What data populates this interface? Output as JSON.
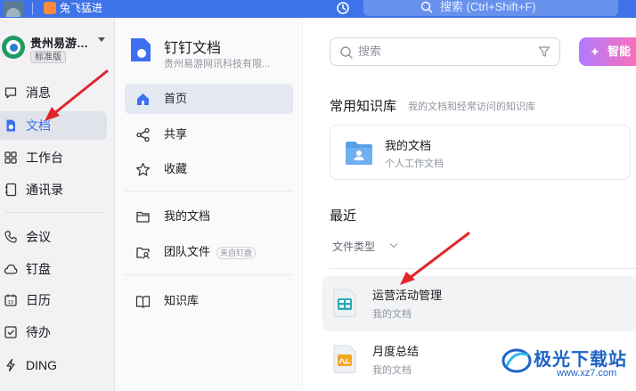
{
  "topbar": {
    "workspace_name": "兔飞猛进",
    "search_placeholder": "搜索 (Ctrl+Shift+F)",
    "color": "#3d72e8"
  },
  "leftnav": {
    "org_name": "贵州易游…",
    "org_badge": "标准版",
    "items": [
      {
        "label": "消息",
        "icon": "chat-icon",
        "active": false
      },
      {
        "label": "文档",
        "icon": "document-icon",
        "active": true
      },
      {
        "label": "工作台",
        "icon": "apps-grid-icon",
        "active": false
      },
      {
        "label": "通讯录",
        "icon": "contacts-icon",
        "active": false
      },
      {
        "label": "会议",
        "icon": "phone-icon",
        "active": false
      },
      {
        "label": "钉盘",
        "icon": "cloud-icon",
        "active": false
      },
      {
        "label": "日历",
        "icon": "calendar-icon",
        "active": false
      },
      {
        "label": "待办",
        "icon": "checkbox-icon",
        "active": false
      },
      {
        "label": "DING",
        "icon": "lightning-icon",
        "active": false
      }
    ]
  },
  "midpanel": {
    "title": "钉钉文档",
    "subtitle": "贵州易游网讯科技有限...",
    "items": [
      {
        "label": "首页",
        "icon": "home-icon",
        "active": true
      },
      {
        "label": "共享",
        "icon": "share-icon",
        "active": false
      },
      {
        "label": "收藏",
        "icon": "star-icon",
        "active": false
      },
      {
        "label": "我的文档",
        "icon": "folder-icon",
        "active": false
      },
      {
        "label": "团队文件",
        "icon": "team-folder-icon",
        "active": false,
        "tag": "来自钉盘"
      },
      {
        "label": "知识库",
        "icon": "book-icon",
        "active": false
      }
    ]
  },
  "main": {
    "search_placeholder": "搜索",
    "ai_button": "智能",
    "kb_section": {
      "title": "常用知识库",
      "subtitle": "我的文档和经常访问的知识库"
    },
    "kb_card": {
      "title": "我的文档",
      "subtitle": "个人工作文档"
    },
    "recent_title": "最近",
    "filter_label": "文件类型",
    "files": [
      {
        "title": "运营活动管理",
        "location": "我的文档",
        "icon": "spreadsheet-icon",
        "color": "#2fa6b5"
      },
      {
        "title": "月度总结",
        "location": "我的文档",
        "icon": "note-icon",
        "color": "#f5a623"
      }
    ]
  },
  "watermark": {
    "text": "极光下载站",
    "url": "www.xz7.com"
  },
  "accent_color": "#3e6ff0",
  "annotation_color": "#e0252b"
}
